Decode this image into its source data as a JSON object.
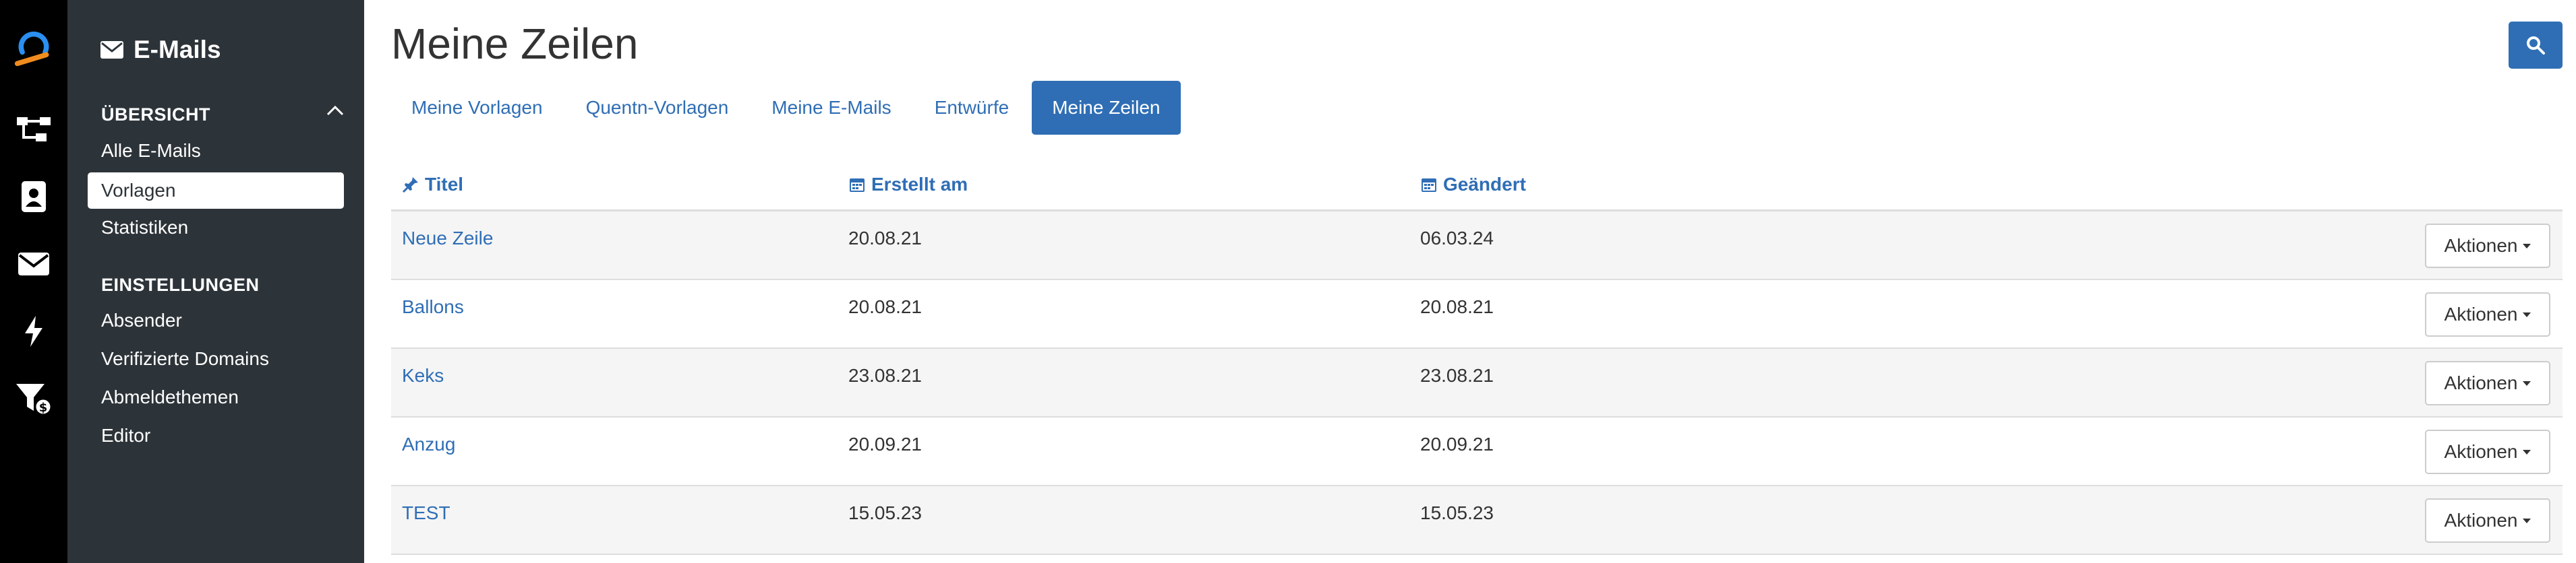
{
  "rail": {
    "icons": [
      "logo-icon",
      "flow-icon",
      "contacts-icon",
      "mail-icon",
      "bolt-icon",
      "filter-revenue-icon"
    ]
  },
  "sidebar": {
    "title": "E-Mails",
    "section_overview": "ÜBERSICHT",
    "overview_items": [
      {
        "label": "Alle E-Mails"
      },
      {
        "label": "Vorlagen"
      },
      {
        "label": "Statistiken"
      }
    ],
    "section_settings": "EINSTELLUNGEN",
    "settings_items": [
      {
        "label": "Absender"
      },
      {
        "label": "Verifizierte Domains"
      },
      {
        "label": "Abmeldethemen"
      },
      {
        "label": "Editor"
      }
    ]
  },
  "main": {
    "title": "Meine Zeilen",
    "tabs": [
      {
        "label": "Meine Vorlagen"
      },
      {
        "label": "Quentn-Vorlagen"
      },
      {
        "label": "Meine E-Mails"
      },
      {
        "label": "Entwürfe"
      },
      {
        "label": "Meine Zeilen"
      }
    ],
    "active_tab": "Meine Zeilen"
  },
  "table": {
    "columns": {
      "title": "Titel",
      "created": "Erstellt am",
      "changed": "Geändert"
    },
    "rows": [
      {
        "title": "Neue Zeile",
        "created": "20.08.21",
        "changed": "06.03.24",
        "action": "Aktionen"
      },
      {
        "title": "Ballons",
        "created": "20.08.21",
        "changed": "20.08.21",
        "action": "Aktionen"
      },
      {
        "title": "Keks",
        "created": "23.08.21",
        "changed": "23.08.21",
        "action": "Aktionen"
      },
      {
        "title": "Anzug",
        "created": "20.09.21",
        "changed": "20.09.21",
        "action": "Aktionen"
      },
      {
        "title": "TEST",
        "created": "15.05.23",
        "changed": "15.05.23",
        "action": "Aktionen"
      }
    ]
  },
  "colors": {
    "accent": "#2f6eb5",
    "sidebar_bg": "#2d3439",
    "rail_bg": "#000000",
    "logo_orange": "#f08c1e",
    "logo_blue": "#2a8ff0"
  }
}
